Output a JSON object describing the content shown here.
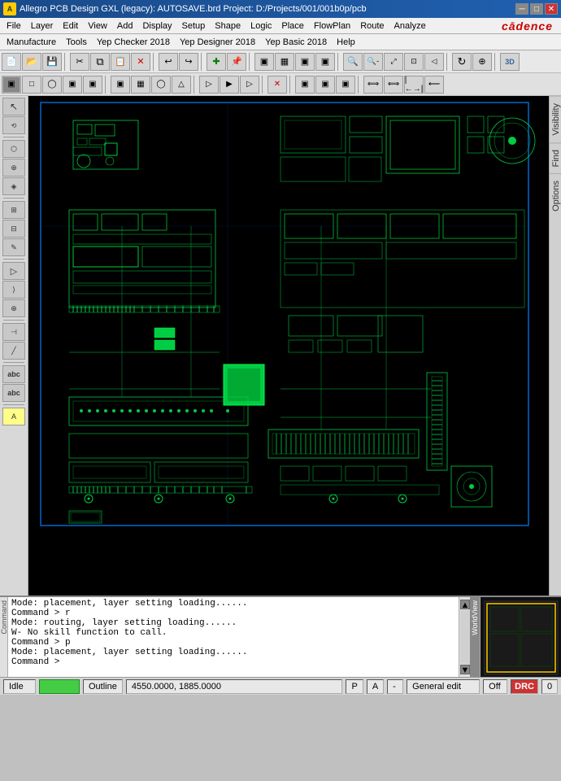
{
  "title_bar": {
    "icon_label": "A",
    "title": "Allegro PCB Design GXL (legacy): AUTOSAVE.brd  Project: D:/Projects/001/001b0p/pcb",
    "minimize": "─",
    "maximize": "□",
    "close": "✕"
  },
  "menu": {
    "items": [
      "File",
      "Layer",
      "Edit",
      "View",
      "Add",
      "Display",
      "Setup",
      "Shape",
      "Logic",
      "Place",
      "FlowPlan",
      "Route",
      "Analyze",
      "Manufacture",
      "Tools",
      "Yep Checker 2018",
      "Yep Designer 2018",
      "Yep Basic 2018",
      "Help"
    ]
  },
  "cadence": {
    "logo": "cādence"
  },
  "toolbar1": {
    "buttons": [
      "📁",
      "💾",
      "✂",
      "📋",
      "↩",
      "↪",
      "✚",
      "📌",
      "▣",
      "▣",
      "▣",
      "▣",
      "▦",
      "🔍",
      "🔍",
      "🔍",
      "🔍",
      "🔍",
      "🔄",
      "🎯",
      "3D"
    ]
  },
  "toolbar2": {
    "buttons": [
      "▣",
      "▣",
      "◯",
      "▣",
      "▣",
      "▣",
      "▣",
      "◯",
      "◯",
      "▷",
      "▷",
      "▷",
      "▷",
      "▷",
      "✕",
      "▣",
      "▣",
      "▣",
      "▣",
      "⟺",
      "⟺"
    ]
  },
  "right_tabs": [
    "Visibility",
    "Find",
    "Options"
  ],
  "console": {
    "lines": [
      "Mode: placement, layer setting loading......",
      "Command > r",
      "Mode: routing, layer setting loading......",
      "W- No skill function to call.",
      "Command > p",
      "Mode: placement, layer setting loading......",
      "Command >"
    ]
  },
  "status_bar": {
    "idle": "Idle",
    "green_bar": "",
    "label_outline": "Outline",
    "coords": "4550.0000, 1885.0000",
    "p_label": "P",
    "a_label": "A",
    "dash": "-",
    "general_edit": "General edit",
    "off_label": "Off",
    "drc": "DRC",
    "count": "0"
  },
  "colors": {
    "pcb_bg": "#000000",
    "pcb_green": "#00ff44",
    "pcb_cyan": "#00ffff",
    "pcb_outline": "#0099ff",
    "status_green": "#44cc44",
    "drc_red": "#cc3333"
  }
}
